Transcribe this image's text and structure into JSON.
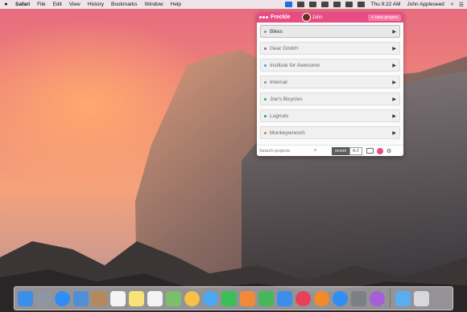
{
  "menubar": {
    "app_name": "Safari",
    "menus": [
      "File",
      "Edit",
      "View",
      "History",
      "Bookmarks",
      "Window",
      "Help"
    ],
    "clock": "Thu 9:22 AM",
    "user": "John Appleseed"
  },
  "freckle": {
    "logo": "Freckle",
    "user_name": "John",
    "new_project_label": "+ new project",
    "projects": [
      {
        "name": "Bikes",
        "color": "#8e8e8e"
      },
      {
        "name": "Gear GmbH",
        "color": "#9b59b6"
      },
      {
        "name": "Institute for Awesome",
        "color": "#3aa7d8"
      },
      {
        "name": "Internal",
        "color": "#8e8e8e"
      },
      {
        "name": "Joe's Bicycles",
        "color": "#27ae60"
      },
      {
        "name": "Lugnuts",
        "color": "#16a085"
      },
      {
        "name": "Monkeywrench",
        "color": "#e67e22"
      }
    ],
    "search_placeholder": "Search projects",
    "sort_recent": "recent",
    "sort_az": "A-Z"
  },
  "dock": {
    "apps": [
      {
        "icon": "finder-icon",
        "color": "#3b8fe8"
      },
      {
        "icon": "launchpad-icon",
        "color": "#8d96a3"
      },
      {
        "icon": "safari-icon",
        "color": "#2f8ef3"
      },
      {
        "icon": "mail-icon",
        "color": "#4f8fd6"
      },
      {
        "icon": "contacts-icon",
        "color": "#b58a5a"
      },
      {
        "icon": "calendar-icon",
        "color": "#f4f4f4"
      },
      {
        "icon": "notes-icon",
        "color": "#f8e27a"
      },
      {
        "icon": "reminders-icon",
        "color": "#f3f3f3"
      },
      {
        "icon": "maps-icon",
        "color": "#7bbf6a"
      },
      {
        "icon": "photos-icon",
        "color": "#f7c04a"
      },
      {
        "icon": "messages-icon",
        "color": "#4aa8f4"
      },
      {
        "icon": "facetime-icon",
        "color": "#3cbf5a"
      },
      {
        "icon": "pages-icon",
        "color": "#f08a3a"
      },
      {
        "icon": "numbers-icon",
        "color": "#46b75a"
      },
      {
        "icon": "keynote-icon",
        "color": "#3b8fe8"
      },
      {
        "icon": "itunes-icon",
        "color": "#e9405a"
      },
      {
        "icon": "ibooks-icon",
        "color": "#f28a2a"
      },
      {
        "icon": "app-store-icon",
        "color": "#2f8ef3"
      },
      {
        "icon": "system-preferences-icon",
        "color": "#7b7f86"
      },
      {
        "icon": "freckle-icon",
        "color": "#a45fd9"
      }
    ],
    "folders": [
      {
        "icon": "downloads-folder-icon",
        "color": "#5aaef0"
      },
      {
        "icon": "trash-icon",
        "color": "#d6d8dc"
      }
    ]
  }
}
